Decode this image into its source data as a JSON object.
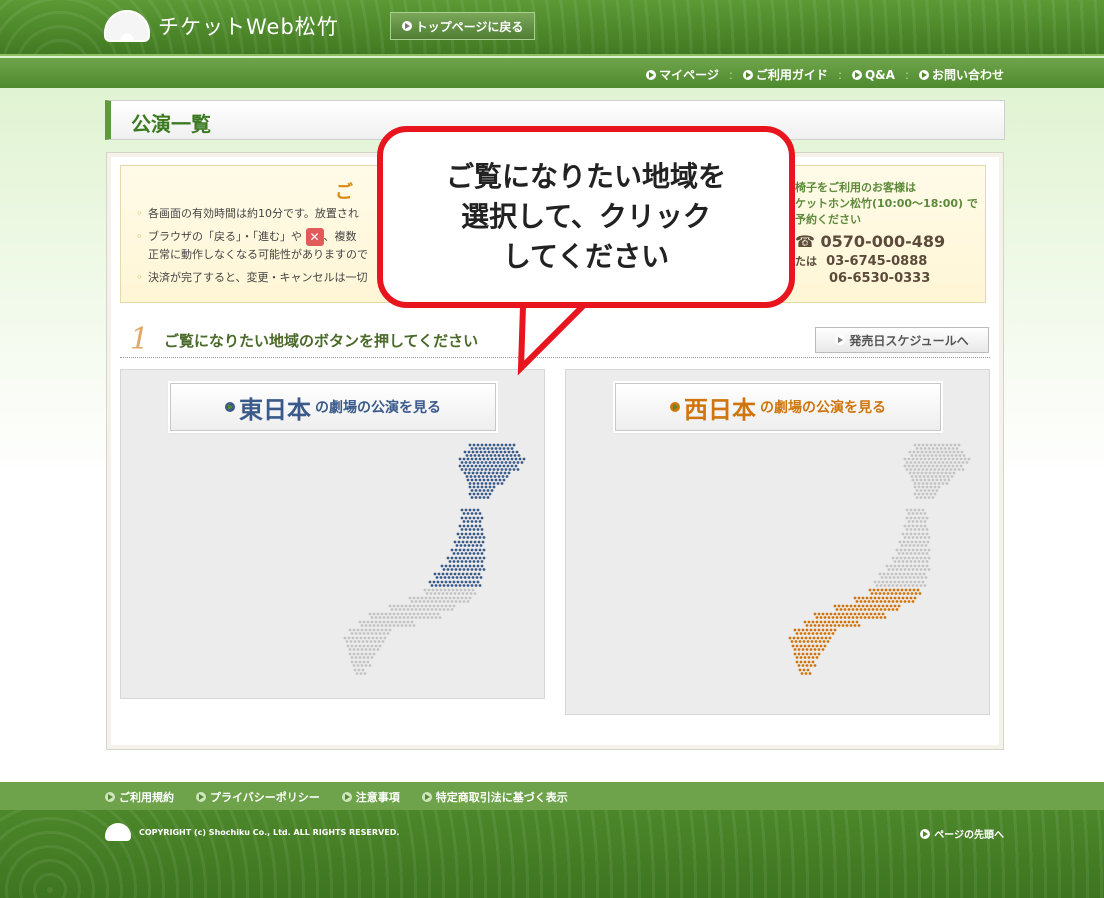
{
  "header": {
    "logo_text": "チケットWeb松竹",
    "top_button_label": "トップページに戻る",
    "nav": [
      {
        "label": "マイページ"
      },
      {
        "label": "ご利用ガイド"
      },
      {
        "label": "Q&A"
      },
      {
        "label": "お問い合わせ"
      }
    ]
  },
  "page_title": "公演一覧",
  "notice": {
    "title": "ご",
    "items": [
      "各画面の有効時間は約10分です。放置され",
      "ブラウザの「戻る」・「進む」や",
      "正常に動作しなくなる可能性がありますので",
      "決済が完了すると、変更・キャンセルは一切"
    ],
    "item2_tail": "、複数",
    "contact": {
      "line1": "椅子をご利用のお客様は",
      "line2": "ケットホン松竹(10:00〜18:00) で",
      "line3": "予約ください",
      "phone_main": "0570-000-489",
      "or_label": "たは",
      "phone_tokyo": "03-6745-0888",
      "phone_osaka": "06-6530-0333"
    }
  },
  "step": {
    "number": "1",
    "text": "ご覧になりたい地域のボタンを押してください",
    "schedule_button": "発売日スケジュールへ"
  },
  "regions": {
    "east": {
      "big": "東日本",
      "small": "の劇場の公演を見る"
    },
    "west": {
      "big": "西日本",
      "small": "の劇場の公演を見る"
    }
  },
  "callout": {
    "text": "ご覧になりたい地域を\n選択して、クリック\nしてください"
  },
  "footer": {
    "links": [
      {
        "label": "ご利用規約"
      },
      {
        "label": "プライバシーポリシー"
      },
      {
        "label": "注意事項"
      },
      {
        "label": "特定商取引法に基づく表示"
      }
    ],
    "copyright": "COPYRIGHT (c) Shochiku Co., Ltd. ALL RIGHTS RESERVED.",
    "page_top": "ページの先頭へ"
  },
  "colors": {
    "brand_green": "#4e8a2c",
    "east_blue": "#3a5a8a",
    "west_orange": "#d0750e",
    "callout_red": "#e8141e",
    "map_gray": "#c4c4c4"
  }
}
